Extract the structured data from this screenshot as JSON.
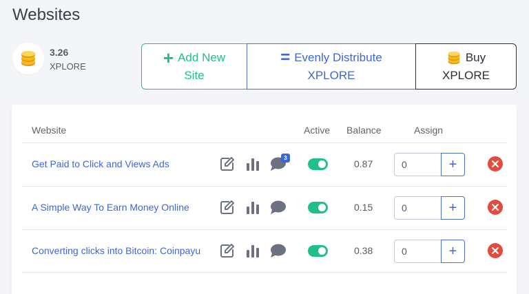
{
  "page": {
    "title": "Websites"
  },
  "wallet": {
    "amount": "3.26",
    "currency": "XPLORE"
  },
  "actions": {
    "add_site": {
      "line1": "Add New",
      "line2": "Site",
      "icon": "plus-icon"
    },
    "distribute": {
      "line1": "Evenly Distribute",
      "line2": "XPLORE",
      "icon": "equals-icon"
    },
    "buy": {
      "line1": "Buy",
      "line2": "XPLORE",
      "icon": "coins-icon"
    }
  },
  "table": {
    "headers": {
      "website": "Website",
      "active": "Active",
      "balance": "Balance",
      "assign": "Assign"
    },
    "rows": [
      {
        "name": "Get Paid to Click and Views Ads",
        "messages": "3",
        "active": true,
        "balance": "0.87",
        "assign_value": "0"
      },
      {
        "name": "A Simple Way To Earn Money Online",
        "messages": "",
        "active": true,
        "balance": "0.15",
        "assign_value": "0"
      },
      {
        "name": "Converting clicks into Bitcoin: Coinpayu",
        "messages": "",
        "active": true,
        "balance": "0.38",
        "assign_value": "0"
      }
    ]
  },
  "colors": {
    "green": "#21c08b",
    "blue": "#3e66d4",
    "red": "#e44b3c",
    "gold": "#f5b921"
  }
}
